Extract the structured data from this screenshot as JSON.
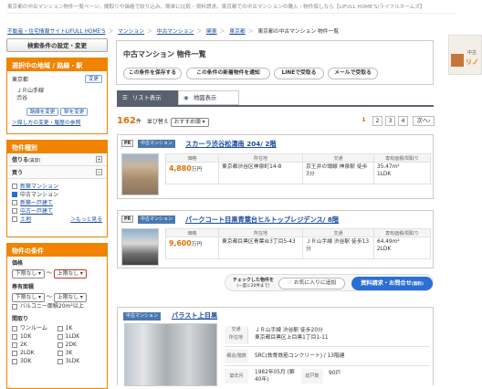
{
  "top_text": "不動産・住宅情報サイトLIFULL HOME'S【ライフルホームズ】",
  "top_desc": "東京都の中古マンション物件一覧ページ。間取りや価格で絞り込み、簡単に比較・資料請求。東京都での中古マンションの購入・物件探しなら【LIFULL HOME'S/ライフルホームズ】",
  "breadcrumbs": [
    "不動産・住宅情報サイトLIFULL HOME'S",
    "マンション",
    "中古マンション",
    "関東",
    "東京都",
    "東京都の中古マンション 物件一覧"
  ],
  "ad": {
    "line1": "中古",
    "line2": "リノ"
  },
  "sidebar": {
    "search_settings": "検索条件の設定・変更",
    "area": {
      "header": "選択中の地域 / 路線・駅",
      "pref": "東京都",
      "change": "変更",
      "line": "ＪＲ山手線",
      "station": "渋谷",
      "btn1": "路線を変更",
      "btn2": "駅を変更",
      "link": "＞探し方の変更・履歴の参照"
    },
    "type": {
      "header": "物件種別",
      "rent_label": "借りる",
      "rent_sub": "(賃貸)",
      "buy_label": "買う",
      "items": [
        "新築マンション",
        "中古マンション",
        "新築一戸建て",
        "中古一戸建て",
        "土地"
      ],
      "more": "＞もっと見る"
    },
    "cond": {
      "header": "物件の条件",
      "price_label": "価格",
      "price_min": "下限なし",
      "price_max": "上限なし",
      "tilde": "〜",
      "area_label": "専有面積",
      "area_min": "下限なし",
      "area_max": "上限なし",
      "balcony": "バルコニー面積20m²以上",
      "layout_label": "間取り",
      "layouts": [
        "ワンルーム",
        "1K",
        "1DK",
        "1LDK",
        "2K",
        "2DK",
        "2LDK",
        "3K",
        "3DK",
        "3LDK"
      ]
    }
  },
  "main": {
    "title": "中古マンション 物件一覧",
    "actions": [
      "この条件を保存する",
      "この条件の新着物件を通知",
      "LINEで受取る",
      "メールで受取る"
    ],
    "tabs": [
      "リスト表示",
      "地図表示"
    ],
    "count": "162",
    "count_unit": "件",
    "sort_label": "並び替え",
    "sort_value": "おすすめ順",
    "pages": [
      "1",
      "2",
      "3",
      "4"
    ],
    "next": "次へ",
    "headers": [
      "価格",
      "所在地",
      "交通",
      "専有面積/間取り"
    ],
    "listings": [
      {
        "pr": "PR",
        "tag": "中古マンション",
        "name": "スカーラ渋谷松濤南 204/ 2階",
        "price": "4,880",
        "unit": "万円",
        "address": "東京都渋谷区神泉町14-8",
        "access": "京王井の頭線 神泉駅 徒歩3分",
        "size": "35.47m²",
        "layout": "1LDK"
      },
      {
        "pr": "PR",
        "tag": "中古マンション",
        "name": "パークコート目黒青葉台ヒルトップレジデンス/ 8階",
        "price": "9,600",
        "unit": "万円",
        "address": "東京都目黒区青葉台3丁目5-43",
        "access": "ＪＲ山手線 渋谷駅 徒歩13分",
        "size": "64.49m²",
        "layout": "2LDK"
      }
    ],
    "check": {
      "label": "チェックした物件を",
      "sub": "(一度に20件まで)",
      "fav": "お気に入りに追加",
      "request": "資料請求・お問合せ",
      "request_sub": "(無料)"
    },
    "third": {
      "tag": "中古マンション",
      "name": "パラスト上目黒",
      "k_access": "交通",
      "k_addr": "所在地",
      "access": "ＪＲ山手線 渋谷駅 徒歩20分",
      "address": "東京都目黒区上目黒1丁目1-11",
      "k_struct": "構造/階数",
      "struct": "SRC(鉄骨鉄筋コンクリート) / 13階建",
      "k_built": "築年月",
      "built": "1982年05月 (築40年)",
      "k_units": "総戸数",
      "units": "90戸"
    }
  }
}
